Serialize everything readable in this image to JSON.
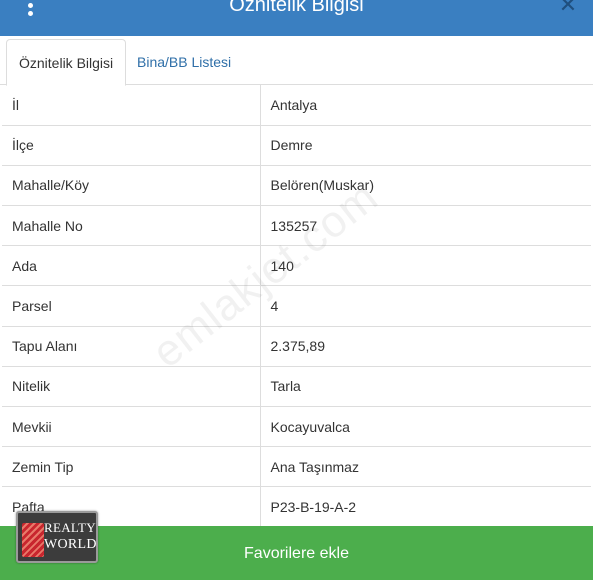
{
  "header": {
    "title": "Öznitelik Bilgisi",
    "menu_icon": "kebab-menu-icon",
    "close_icon": "close-icon",
    "close_glyph": "✕",
    "background_color": "#3a7fc1"
  },
  "tabs": [
    {
      "label": "Öznitelik Bilgisi",
      "active": true
    },
    {
      "label": "Bina/BB Listesi",
      "active": false
    }
  ],
  "attributes": [
    {
      "key": "İl",
      "value": "Antalya"
    },
    {
      "key": "İlçe",
      "value": "Demre"
    },
    {
      "key": "Mahalle/Köy",
      "value": "Belören(Muskar)"
    },
    {
      "key": "Mahalle No",
      "value": "135257"
    },
    {
      "key": "Ada",
      "value": "140"
    },
    {
      "key": "Parsel",
      "value": "4"
    },
    {
      "key": "Tapu Alanı",
      "value": "2.375,89"
    },
    {
      "key": "Nitelik",
      "value": "Tarla"
    },
    {
      "key": "Mevkii",
      "value": "Kocayuvalca"
    },
    {
      "key": "Zemin Tip",
      "value": "Ana Taşınmaz"
    },
    {
      "key": "Pafta",
      "value": "P23-B-19-A-2"
    }
  ],
  "watermark": "emlakjet.com",
  "footer": {
    "button_label": "Favorilere ekle",
    "button_color": "#4cae4c"
  },
  "logo": {
    "line1": "REALTY",
    "line2": "WORLD"
  }
}
